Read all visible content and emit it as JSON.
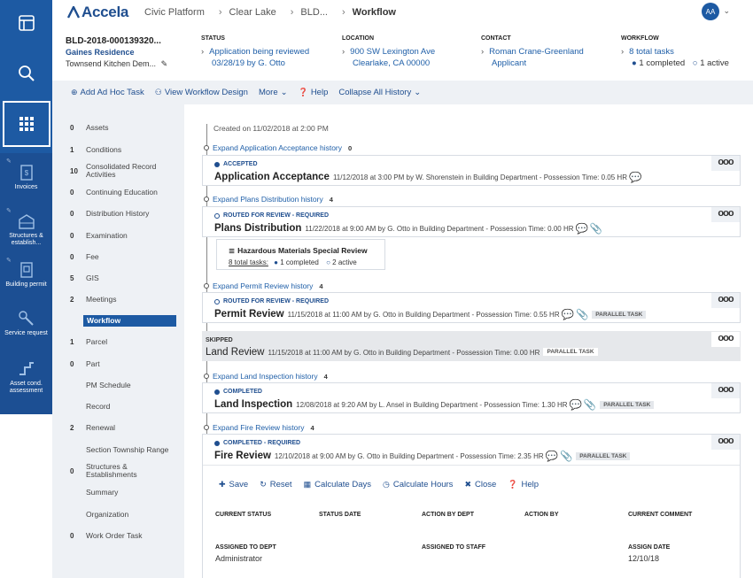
{
  "app": {
    "logo": "Accela"
  },
  "breadcrumb": [
    "Civic Platform",
    "Clear Lake",
    "BLD...",
    "Workflow"
  ],
  "user": {
    "initials": "AA"
  },
  "rail": [
    {
      "label": "Invoices"
    },
    {
      "label": "Structures & establish..."
    },
    {
      "label": "Building permit"
    },
    {
      "label": "Service request"
    },
    {
      "label": "Asset cond. assessment"
    }
  ],
  "record": {
    "id": "BLD-2018-000139320...",
    "name": "Gaines Residence",
    "description": "Townsend Kitchen Dem...",
    "status": {
      "label": "STATUS",
      "line1": "Application being reviewed",
      "line2": "03/28/19 by G. Otto"
    },
    "location": {
      "label": "LOCATION",
      "line1": "900 SW Lexington Ave",
      "line2": "Clearlake, CA 00000"
    },
    "contact": {
      "label": "CONTACT",
      "line1": "Roman Crane-Greenland",
      "line2": "Applicant"
    },
    "workflow": {
      "label": "WORKFLOW",
      "total": "8 total tasks",
      "completed": "1 completed",
      "active": "1 active"
    }
  },
  "toolbar": {
    "add_task": "Add Ad Hoc Task",
    "view_design": "View Workflow Design",
    "more": "More",
    "help": "Help",
    "collapse": "Collapse All History"
  },
  "nav": [
    {
      "count": "0",
      "label": "Assets"
    },
    {
      "count": "1",
      "label": "Conditions"
    },
    {
      "count": "10",
      "label": "Consolidated Record Activities"
    },
    {
      "count": "0",
      "label": "Continuing Education"
    },
    {
      "count": "0",
      "label": "Distribution History"
    },
    {
      "count": "0",
      "label": "Examination"
    },
    {
      "count": "0",
      "label": "Fee"
    },
    {
      "count": "5",
      "label": "GIS"
    },
    {
      "count": "2",
      "label": "Meetings"
    },
    {
      "count": "",
      "label": "Workflow"
    },
    {
      "count": "1",
      "label": "Parcel"
    },
    {
      "count": "0",
      "label": "Part"
    },
    {
      "count": "",
      "label": "PM Schedule"
    },
    {
      "count": "",
      "label": "Record"
    },
    {
      "count": "2",
      "label": "Renewal"
    },
    {
      "count": "",
      "label": "Section Township Range"
    },
    {
      "count": "0",
      "label": "Structures & Establishments"
    },
    {
      "count": "",
      "label": "Summary"
    },
    {
      "count": "",
      "label": "Organization"
    },
    {
      "count": "0",
      "label": "Work Order Task"
    }
  ],
  "workflow": {
    "created": "Created on 11/02/2018 at 2:00 PM",
    "expand": [
      {
        "label": "Expand Application Acceptance history",
        "count": "0"
      },
      {
        "label": "Expand Plans Distribution history",
        "count": "4"
      },
      {
        "label": "Expand Permit Review history",
        "count": "4"
      },
      {
        "label": "Expand Land Inspection history",
        "count": "4"
      },
      {
        "label": "Expand Fire Review history",
        "count": "4"
      }
    ],
    "tasks": [
      {
        "status": "ACCEPTED",
        "title": "Application Acceptance",
        "meta": "11/12/2018 at 3:00 PM by W. Shorenstein in Building Department - Possession Time: 0.05 HR"
      },
      {
        "status": "ROUTED FOR REVIEW - REQUIRED",
        "title": "Plans Distribution",
        "meta": "11/22/2018 at 9:00 AM by G. Otto in Building Department - Possession Time: 0.00 HR"
      },
      {
        "status": "ROUTED FOR REVIEW - REQUIRED",
        "title": "Permit Review",
        "meta": "11/15/2018 at 11:00 AM by G. Otto in Building Department - Possession Time: 0.55 HR",
        "pill": "PARALLEL TASK"
      },
      {
        "status": "SKIPPED",
        "title": "Land Review",
        "meta": "11/15/2018 at 11:00 AM by G. Otto in Building Department - Possession Time: 0.00 HR",
        "pill": "PARALLEL TASK"
      },
      {
        "status": "COMPLETED",
        "title": "Land Inspection",
        "meta": "12/08/2018 at 9:20 AM by L. Ansel in Building Department - Possession Time: 1.30 HR",
        "pill": "PARALLEL TASK"
      },
      {
        "status": "COMPLETED - REQUIRED",
        "title": "Fire Review",
        "meta": "12/10/2018 at 9:00 AM by G. Otto in Building Department - Possession Time: 2.35 HR",
        "pill": "PARALLEL TASK"
      }
    ],
    "more_label": "ooo",
    "subtask": {
      "title": "Hazardous Materials Special Review",
      "total": "8 total tasks:",
      "completed": "1 completed",
      "active": "2 active"
    }
  },
  "form": {
    "actions": [
      "Save",
      "Reset",
      "Calculate Days",
      "Calculate Hours",
      "Close",
      "Help"
    ],
    "headers": [
      "CURRENT STATUS",
      "STATUS DATE",
      "ACTION BY DEPT",
      "ACTION BY",
      "CURRENT COMMENT"
    ],
    "assigned_dept_label": "ASSIGNED TO DEPT",
    "assigned_dept": "Administrator",
    "assigned_staff_label": "ASSIGNED TO STAFF",
    "assign_date_label": "ASSIGN DATE",
    "assign_date": "12/10/18"
  }
}
